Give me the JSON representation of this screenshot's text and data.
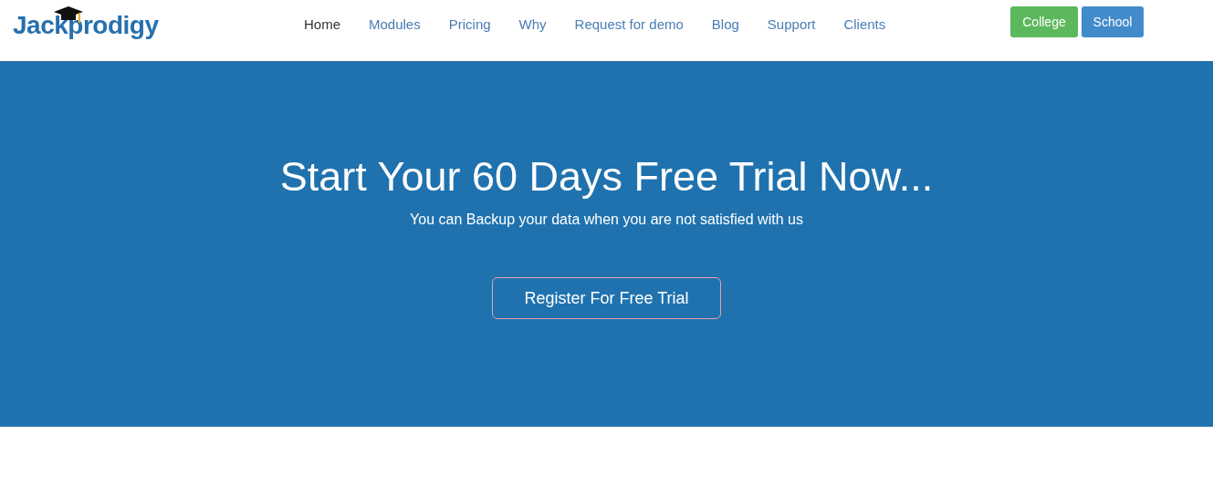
{
  "logo": {
    "text": "Jackprodigy"
  },
  "nav": [
    {
      "label": "Home",
      "selected": true
    },
    {
      "label": "Modules",
      "selected": false
    },
    {
      "label": "Pricing",
      "selected": false
    },
    {
      "label": "Why",
      "selected": false
    },
    {
      "label": "Request for demo",
      "selected": false
    },
    {
      "label": "Blog",
      "selected": false
    },
    {
      "label": "Support",
      "selected": false
    },
    {
      "label": "Clients",
      "selected": false
    }
  ],
  "buttons": [
    {
      "label": "College",
      "color": "#5cb85c"
    },
    {
      "label": "School",
      "color": "#428bca"
    }
  ],
  "hero": {
    "title": "Start Your 60 Days Free Trial Now...",
    "subtitle": "You can Backup your data when you are not satisfied with us",
    "cta": "Register For Free Trial"
  }
}
